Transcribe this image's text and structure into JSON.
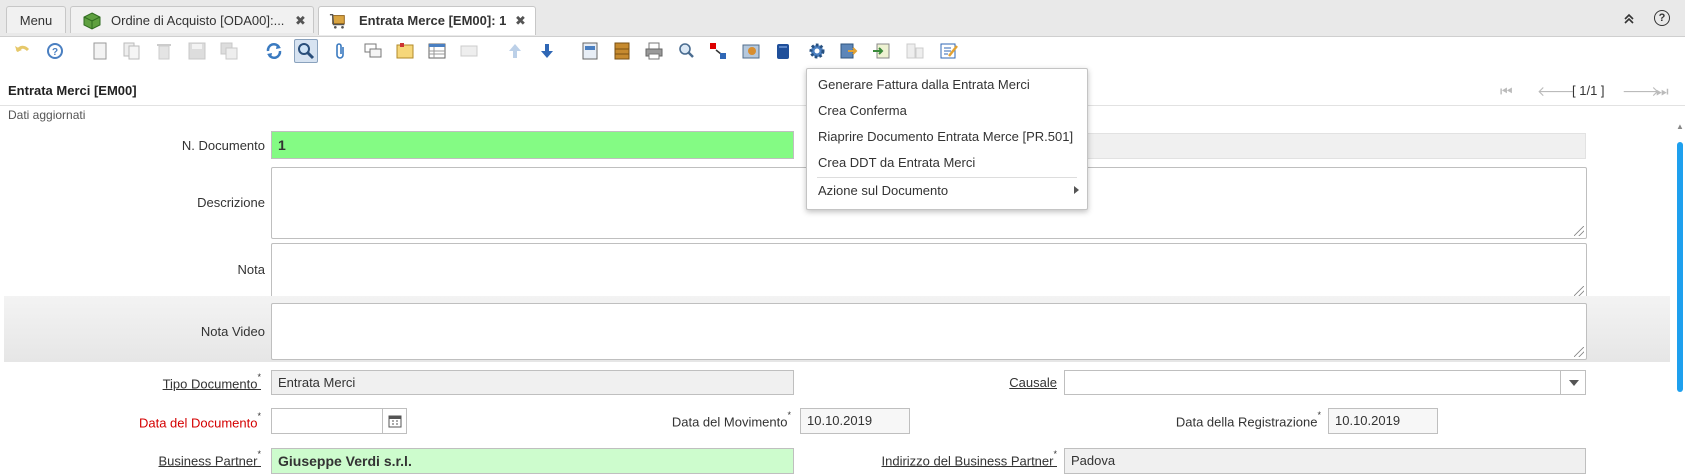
{
  "tabs": {
    "menu": "Menu",
    "order": "Ordine di Acquisto [ODA00]:...",
    "receipt": "Entrata Merce [EM00]: 1"
  },
  "window": {
    "title": "Entrata Merci [EM00]",
    "page_indicator": "[ 1/1 ]",
    "status": "Dati aggiornati"
  },
  "form": {
    "doc_no": {
      "label": "N. Documento",
      "value": "1"
    },
    "description": {
      "label": "Descrizione",
      "value": ""
    },
    "note": {
      "label": "Nota",
      "value": ""
    },
    "video_note": {
      "label": "Nota Video",
      "value": ""
    },
    "doc_type": {
      "label": "Tipo Documento",
      "value": "Entrata Merci"
    },
    "reason": {
      "label": "Causale",
      "value": ""
    },
    "doc_date": {
      "label": "Data del Documento",
      "value": ""
    },
    "movement_date": {
      "label": "Data del Movimento",
      "value": "10.10.2019"
    },
    "reg_date": {
      "label": "Data della Registrazione",
      "value": "10.10.2019"
    },
    "partner": {
      "label": "Business Partner",
      "value": "Giuseppe Verdi s.r.l."
    },
    "partner_address": {
      "label": "Indirizzo del Business Partner",
      "value": "Padova"
    },
    "required_mark": "*"
  },
  "context_menu": {
    "items": [
      "Generare Fattura dalla Entrata Merci",
      "Crea Conferma",
      "Riaprire Documento Entrata Merce [PR.501]",
      "Crea DDT da Entrata Merci",
      "Azione sul Documento"
    ]
  },
  "colors": {
    "mandatory_green": "#84fb84",
    "readonly_green": "#cdfccd",
    "required_red": "#d40000",
    "scrollbar": "#1ea0ee"
  }
}
